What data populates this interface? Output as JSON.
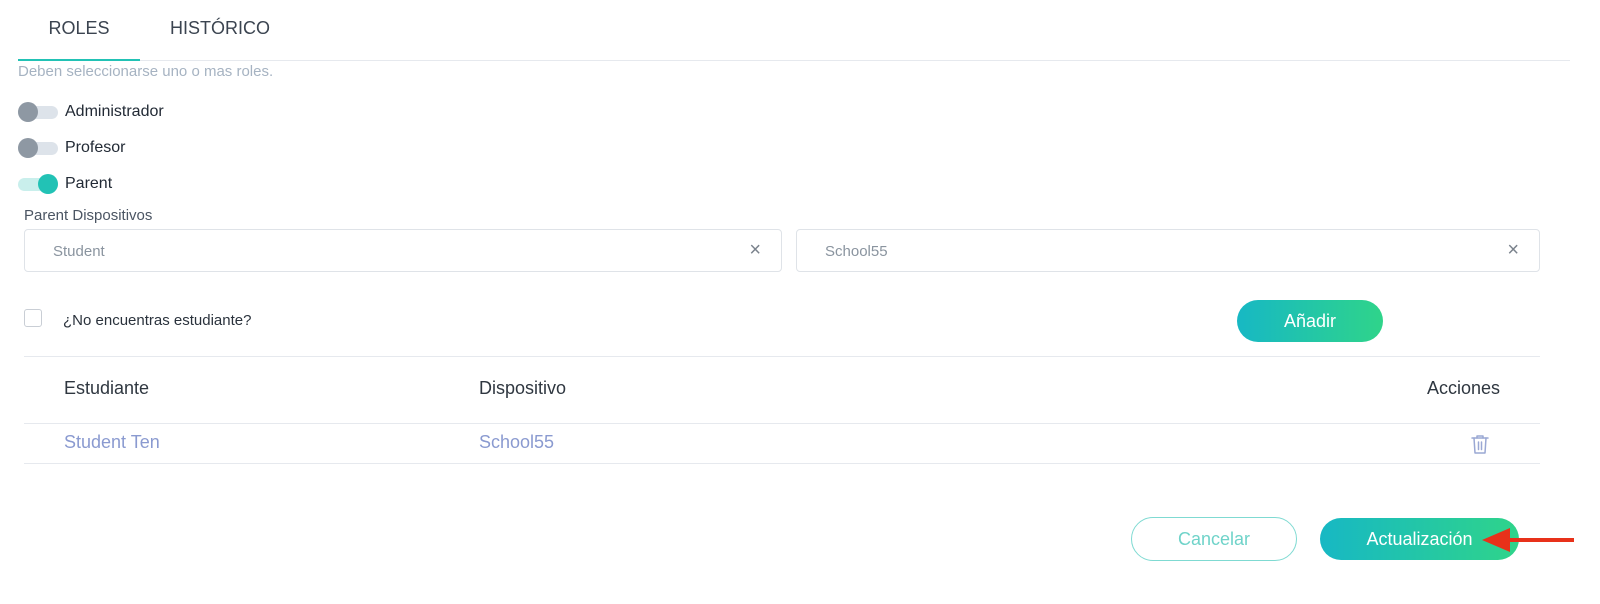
{
  "tabs": [
    {
      "label": "ROLES",
      "active": true
    },
    {
      "label": "HISTÓRICO",
      "active": false
    }
  ],
  "hint": "Deben seleccionarse uno o mas roles.",
  "roles": [
    {
      "label": "Administrador",
      "enabled": false
    },
    {
      "label": "Profesor",
      "enabled": false
    },
    {
      "label": "Parent",
      "enabled": true
    }
  ],
  "parent_devices": {
    "label": "Parent Dispositivos",
    "student_select": {
      "value": "Student"
    },
    "device_select": {
      "value": "School55"
    },
    "clear_symbol": "×",
    "no_student_checkbox": {
      "label": "¿No encuentras estudiante?",
      "checked": false
    },
    "add_button": "Añadir"
  },
  "table": {
    "columns": [
      "Estudiante",
      "Dispositivo",
      "Acciones"
    ],
    "rows": [
      {
        "student": "Student Ten",
        "device": "School55",
        "action_icon": "trash-icon"
      }
    ]
  },
  "footer": {
    "cancel_button": "Cancelar",
    "update_button": "Actualización"
  },
  "colors": {
    "accent": "#22c2b5",
    "gradient_start": "#17b8c4",
    "gradient_end": "#2fd48a",
    "annotation_arrow": "#e8311a"
  }
}
